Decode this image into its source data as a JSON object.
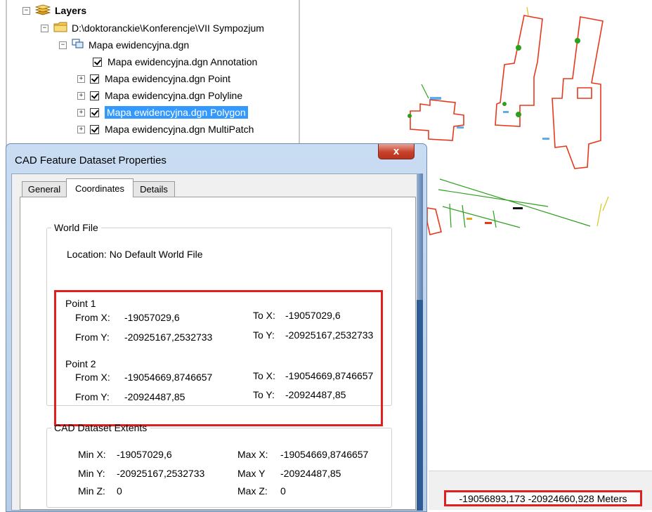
{
  "toc": {
    "root_label": "Layers",
    "folder_label": "D:\\doktoranckie\\Konferencje\\VII Sympozjum",
    "dataset_label": "Mapa ewidencyjna.dgn",
    "layers": [
      {
        "label": "Mapa ewidencyjna.dgn Annotation",
        "expander": "",
        "selected": false
      },
      {
        "label": "Mapa ewidencyjna.dgn Point",
        "expander": "+",
        "selected": false
      },
      {
        "label": "Mapa ewidencyjna.dgn Polyline",
        "expander": "+",
        "selected": false
      },
      {
        "label": "Mapa ewidencyjna.dgn Polygon",
        "expander": "+",
        "selected": true
      },
      {
        "label": "Mapa ewidencyjna.dgn MultiPatch",
        "expander": "+",
        "selected": false
      }
    ],
    "expander_open": "−",
    "expander_closed": "+"
  },
  "dialog": {
    "title": "CAD Feature Dataset Properties",
    "close_glyph": "x",
    "tabs": [
      {
        "label": "General",
        "active": false
      },
      {
        "label": "Coordinates",
        "active": true
      },
      {
        "label": "Details",
        "active": false
      }
    ],
    "world_file": {
      "legend": "World File",
      "location": "Location:  No Default World File",
      "point1": {
        "label": "Point 1",
        "from_x_label": "From X:",
        "from_x": "-19057029,6",
        "from_y_label": "From Y:",
        "from_y": "-20925167,2532733",
        "to_x_label": "To X:",
        "to_x": "-19057029,6",
        "to_y_label": "To Y:",
        "to_y": "-20925167,2532733"
      },
      "point2": {
        "label": "Point 2",
        "from_x_label": "From X:",
        "from_x": "-19054669,8746657",
        "from_y_label": "From Y:",
        "from_y": "-20924487,85",
        "to_x_label": "To X:",
        "to_x": "-19054669,8746657",
        "to_y_label": "To Y:",
        "to_y": "-20924487,85"
      }
    },
    "extents": {
      "legend": "CAD Dataset Extents",
      "min_x_label": "Min X:",
      "min_x": "-19057029,6",
      "max_x_label": "Max X:",
      "max_x": "-19054669,8746657",
      "min_y_label": "Min Y:",
      "min_y": "-20925167,2532733",
      "max_y_label": "Max Y",
      "max_y": "-20924487,85",
      "min_z_label": "Min Z:",
      "min_z": "0",
      "max_z_label": "Max Z:",
      "max_z": "0"
    }
  },
  "status_bar": {
    "coordinates": "-19056893,173  -20924660,928 Meters"
  },
  "colors": {
    "polygon": "#e8381c",
    "polyline": "#2ca01c",
    "point": "#1a8ae0",
    "annotation_box": "#e02020",
    "selection": "#3399ff"
  },
  "icons": {
    "layers": "layers-stack-icon",
    "folder": "folder-icon",
    "dataset": "cad-dataset-icon",
    "checkbox": "checkbox-checked-icon"
  }
}
